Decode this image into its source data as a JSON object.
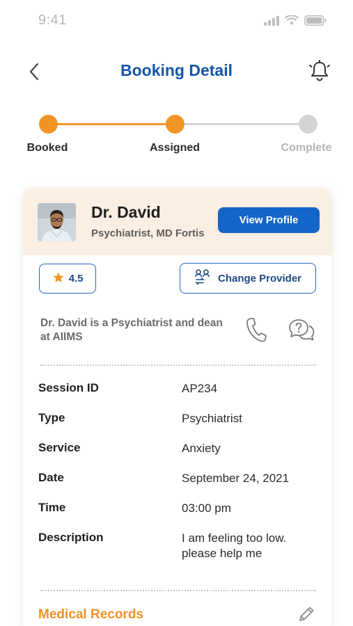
{
  "status_bar": {
    "time": "9:41"
  },
  "header": {
    "title": "Booking Detail"
  },
  "stepper": {
    "steps": [
      {
        "label": "Booked",
        "state": "done"
      },
      {
        "label": "Assigned",
        "state": "done"
      },
      {
        "label": "Complete",
        "state": "todo"
      }
    ]
  },
  "doctor": {
    "name": "Dr. David",
    "specialty": "Psychiatrist, MD Fortis",
    "view_profile_label": "View Profile",
    "rating": "4.5",
    "change_provider_label": "Change Provider",
    "bio": "Dr. David is a Psychiatrist and dean at AIIMS"
  },
  "details": [
    {
      "key": "Session ID",
      "value": "AP234"
    },
    {
      "key": "Type",
      "value": "Psychiatrist"
    },
    {
      "key": "Service",
      "value": "Anxiety"
    },
    {
      "key": "Date",
      "value": "September 24, 2021"
    },
    {
      "key": "Time",
      "value": "03:00 pm"
    },
    {
      "key": "Description",
      "value": "I am feeling too low. please help me"
    }
  ],
  "medical_records": {
    "title": "Medical Records"
  },
  "colors": {
    "primary": "#1565c8",
    "title": "#1456a8",
    "accent": "#f29424",
    "inactive": "#d4d4d4",
    "header_bg": "#fbeee2"
  },
  "icons": [
    "back-chevron-icon",
    "bell-icon",
    "star-icon",
    "change-provider-icon",
    "phone-icon",
    "chat-question-icon",
    "pencil-icon",
    "signal-icon",
    "wifi-icon",
    "battery-icon"
  ]
}
